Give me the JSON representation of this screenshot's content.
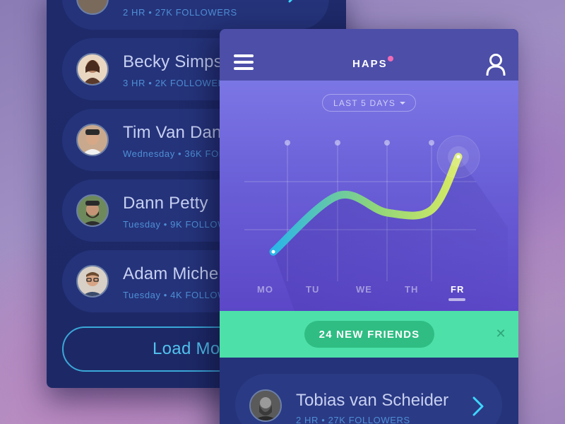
{
  "follower_list": {
    "rows": [
      {
        "name": "",
        "meta": "2 HR • 27K FOLLOWERS"
      },
      {
        "name": "Becky Simps",
        "meta": "3 HR • 2K FOLLOWER"
      },
      {
        "name": "Tim Van Dan",
        "meta": "Wednesday • 36K FOLLO"
      },
      {
        "name": "Dann Petty",
        "meta": "Tuesday • 9K FOLLOW"
      },
      {
        "name": "Adam Miche",
        "meta": "Tuesday • 4K FOLLOW"
      }
    ],
    "load_more_label": "Load Mo"
  },
  "app": {
    "brand": "HAPS",
    "notification_dot_color": "#f06bb5",
    "icons": {
      "menu": "hamburger-menu-icon",
      "profile": "user-icon",
      "dropdown": "caret-down-icon",
      "close": "close-icon",
      "next": "chevron-right-icon"
    }
  },
  "range_selector": {
    "label": "LAST 5 DAYS"
  },
  "chart_data": {
    "type": "line",
    "x": [
      "MO",
      "TU",
      "WE",
      "TH",
      "FR"
    ],
    "selected": "FR",
    "series": [
      {
        "values": [
          1.0,
          3.0,
          2.4,
          2.5,
          4.4
        ]
      }
    ],
    "grid": true,
    "gradient": [
      "#2ab6e8",
      "#8fd57a",
      "#d8ea62"
    ]
  },
  "friends_banner": {
    "label": "24 NEW FRIENDS"
  },
  "featured_user": {
    "name": "Tobias van Scheider",
    "meta": "2 HR • 27K FOLLOWERS"
  }
}
